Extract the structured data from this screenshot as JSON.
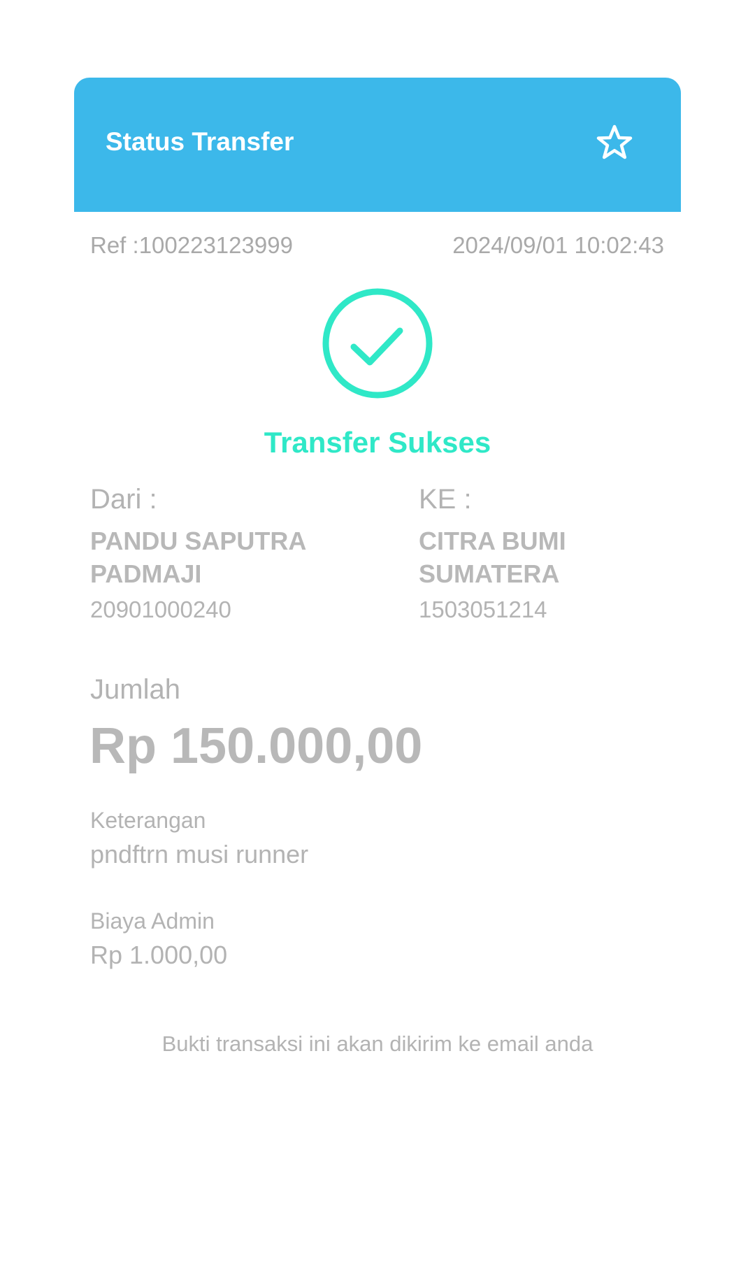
{
  "header": {
    "title": "Status Transfer",
    "favorite_icon": "star-outline-icon",
    "color": "#3cb8ea"
  },
  "meta": {
    "ref": "Ref :100223123999",
    "datetime": "2024/09/01 10:02:43"
  },
  "status": {
    "icon": "check-circle-icon",
    "text": "Transfer Sukses",
    "color": "#2fe8c7"
  },
  "from": {
    "label": "Dari :",
    "name": "PANDU SAPUTRA PADMAJI",
    "account": "20901000240"
  },
  "to": {
    "label": "KE :",
    "name": "CITRA BUMI SUMATERA",
    "account": "1503051214"
  },
  "amount": {
    "label": "Jumlah",
    "value": "Rp 150.000,00"
  },
  "description": {
    "label": "Keterangan",
    "value": "pndftrn musi runner"
  },
  "fee": {
    "label": "Biaya Admin",
    "value": "Rp 1.000,00"
  },
  "footnote": "Bukti transaksi ini akan dikirim ke email anda"
}
